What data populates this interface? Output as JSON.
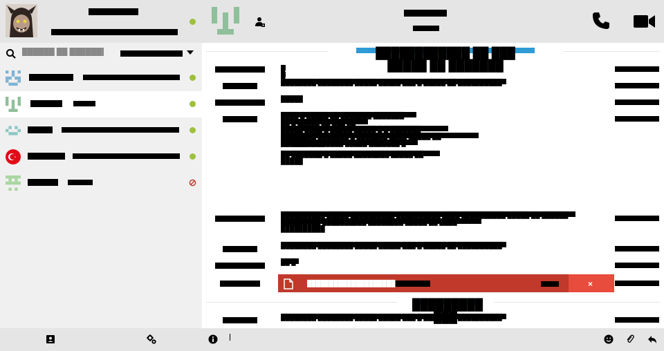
{
  "profile": {
    "name": "██████████",
    "status": "█████ ████ ████████████"
  },
  "search": {
    "placeholder": "██████ ██ ███████████",
    "filter_label": "██████ ███████"
  },
  "contacts": [
    {
      "name": "███████",
      "message": "████ ██ ███ ███████ █████",
      "status": "online",
      "avatar_icon": "identicon-blue-icon",
      "selected": false
    },
    {
      "name": "█████",
      "message": "█████",
      "status": "online",
      "avatar_icon": "identicon-green-icon",
      "selected": true
    },
    {
      "name": "████",
      "message": "█ ███ ███████ ███ █████ ██ ████",
      "status": "online",
      "avatar_icon": "identicon-teal-icon",
      "selected": false
    },
    {
      "name": "██████",
      "message": "██████ ████ ███████ ██ █████",
      "status": "online",
      "avatar_icon": "turkey-flag-icon",
      "selected": false
    },
    {
      "name": "█████",
      "message": "███████",
      "status": "blocked",
      "avatar_icon": "identicon-lightgreen-icon",
      "selected": false
    }
  ],
  "chat_header": {
    "title": "████████",
    "subtitle": "█████"
  },
  "day_separators": [
    {
      "label": "████████████ ██ ███ █████ ██ ███████"
    },
    {
      "label": "█████████ ███"
    }
  ],
  "messages": [
    {
      "author": "████████████",
      "lines": [
        "█",
        "█"
      ],
      "time": "█████████ ██"
    },
    {
      "author": "████████",
      "lines": [
        "████████ ████████ █████ █████ ███ █ █████ ██ ██████████"
      ],
      "time": "█████████ ██"
    },
    {
      "author": "████████████",
      "lines": [
        "█████"
      ],
      "time": "█████████ ██"
    },
    {
      "author": "████████",
      "lines": [
        "████ █ █████ ██ ███████ ███████",
        "██ █ █████ ██ ███ ██",
        "█████ ████ █ █████ █████ █ █ ███████ ██████",
        "████████ ███████ █ ███████ ████ █████ ██ ██████████",
        "██ ████ █ ██████ █████ ███████ █",
        "██ ███████ █ █████ ████████ █████ ██ █████"
      ],
      "time": "█████████ ██"
    },
    {
      "author": "████████████",
      "lines": [
        "██████████ █████ ██████████ ██████████ ████ ██████████ █████ ██ ██████ ████",
        "█████████ ██████████ ████████ █████ ██ ████ ██████████"
      ],
      "time": "█████████ ██"
    },
    {
      "author": "████████",
      "lines": [
        "████████ ████████ █████ █████ ███ █ █████ ██ ██████████"
      ],
      "time": "█████████ ██"
    },
    {
      "author": "████████████",
      "lines": [
        "██ █"
      ],
      "time": "█████████ ██"
    },
    {
      "author": "██████████",
      "lines": [],
      "time": "█████████ ██"
    },
    {
      "author": "████████",
      "lines": [
        "████████ ████████ █████ █████ ███ █ █████ ██ ██████████"
      ],
      "time": "█████████ ██"
    }
  ],
  "file_transfer": {
    "name": "████████████████████",
    "size": "█ ██",
    "close_label": "×"
  },
  "compose": {
    "placeholder": ""
  },
  "colors": {
    "accent_blue": "#2e9bd6",
    "online_green": "#9dc13a",
    "blocked_red": "#c0392b",
    "file_bar": "#c0392b",
    "file_close": "#e74c3c"
  }
}
